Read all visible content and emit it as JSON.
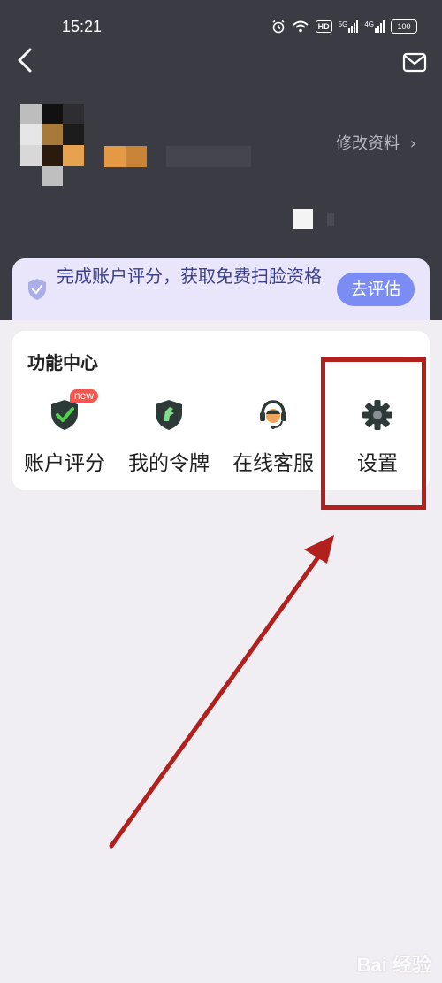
{
  "status_bar": {
    "time": "15:21",
    "hd_label": "HD",
    "net_5g": "5G",
    "net_4g": "4G",
    "battery": "100",
    "icons": [
      "alarm-icon",
      "wifi-icon",
      "hd-icon",
      "signal-5g-icon",
      "signal-4g-icon",
      "battery-icon"
    ]
  },
  "header": {
    "background": "#3b3b43",
    "edit_profile_label": "修改资料",
    "chevron": "›"
  },
  "banner": {
    "text": "完成账户评分，获取免费扫脸资格",
    "button_label": "去评估",
    "accent": "#7b8df5"
  },
  "function_center": {
    "title": "功能中心",
    "items": [
      {
        "label": "账户评分",
        "icon": "shield-check-icon",
        "badge": "new"
      },
      {
        "label": "我的令牌",
        "icon": "token-shield-icon"
      },
      {
        "label": "在线客服",
        "icon": "customer-service-icon"
      },
      {
        "label": "设置",
        "icon": "gear-icon"
      }
    ]
  },
  "annotation": {
    "highlight_color": "#b2201d"
  },
  "watermark": "Bai 经验"
}
